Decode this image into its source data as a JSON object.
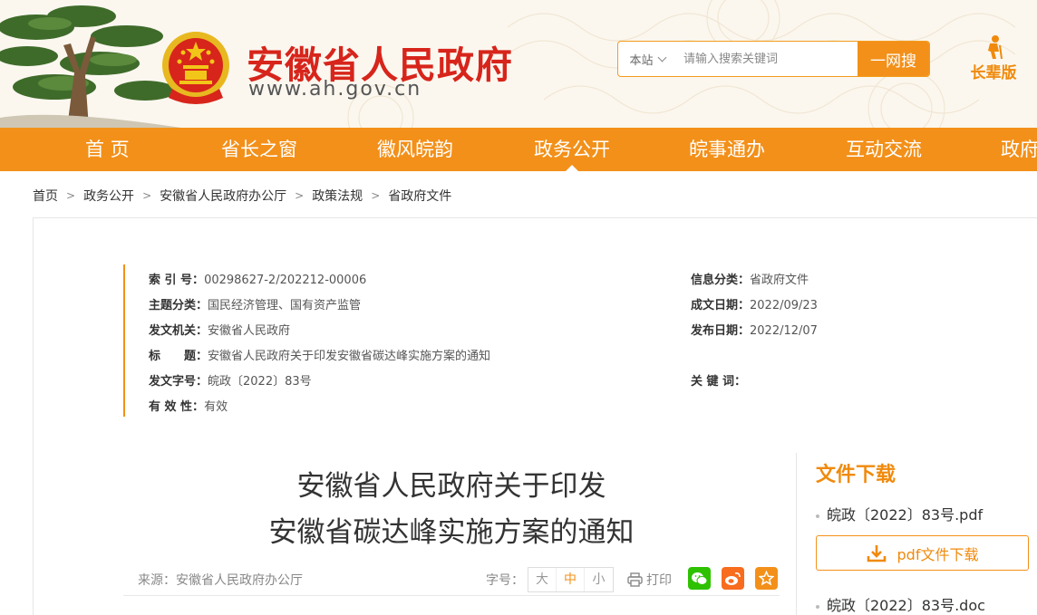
{
  "header": {
    "site_name": "安徽省人民政府",
    "site_url": "www.ah.gov.cn",
    "search": {
      "scope": "本站",
      "placeholder": "请输入搜索关键词",
      "button": "一网搜"
    },
    "elder_mode": "长辈版"
  },
  "nav": {
    "items": [
      "首 页",
      "省长之窗",
      "徽风皖韵",
      "政务公开",
      "皖事通办",
      "互动交流",
      "政府"
    ],
    "active_index": 3
  },
  "breadcrumb": [
    "首页",
    "政务公开",
    "安徽省人民政府办公厅",
    "政策法规",
    "省政府文件"
  ],
  "breadcrumb_separator": ">",
  "meta": {
    "index_no": {
      "label": "索 引 号：",
      "value": "00298627-2/202212-00006"
    },
    "topic": {
      "label": "主题分类：",
      "value": "国民经济管理、国有资产监管"
    },
    "issuer": {
      "label": "发文机关：",
      "value": "安徽省人民政府"
    },
    "title": {
      "label": "标　　题：",
      "value": "安徽省人民政府关于印发安徽省碳达峰实施方案的通知"
    },
    "doc_no": {
      "label": "发文字号：",
      "value": "皖政〔2022〕83号"
    },
    "validity": {
      "label": "有 效 性：",
      "value": "有效"
    },
    "info_category": {
      "label": "信息分类：",
      "value": "省政府文件"
    },
    "created_date": {
      "label": "成文日期：",
      "value": "2022/09/23"
    },
    "publish_date": {
      "label": "发布日期：",
      "value": "2022/12/07"
    },
    "keywords": {
      "label": "关 键 词：",
      "value": ""
    }
  },
  "article": {
    "title_line1": "安徽省人民政府关于印发",
    "title_line2": "安徽省碳达峰实施方案的通知",
    "source": "来源：安徽省人民政府办公厅",
    "font_size_label": "字号：",
    "font_sizes": [
      "大",
      "中",
      "小"
    ],
    "font_size_selected": "中",
    "print": "打印",
    "share": [
      "wechat",
      "weibo",
      "favorite"
    ]
  },
  "downloads": {
    "title": "文件下载",
    "files": [
      {
        "name": "皖政〔2022〕83号.pdf",
        "button": "pdf文件下载"
      },
      {
        "name": "皖政〔2022〕83号.doc"
      }
    ]
  },
  "colors": {
    "brand_orange": "#f39019",
    "title_red": "#d7251b",
    "wechat_green": "#2dc100",
    "weibo_orange": "#f86c1e"
  }
}
